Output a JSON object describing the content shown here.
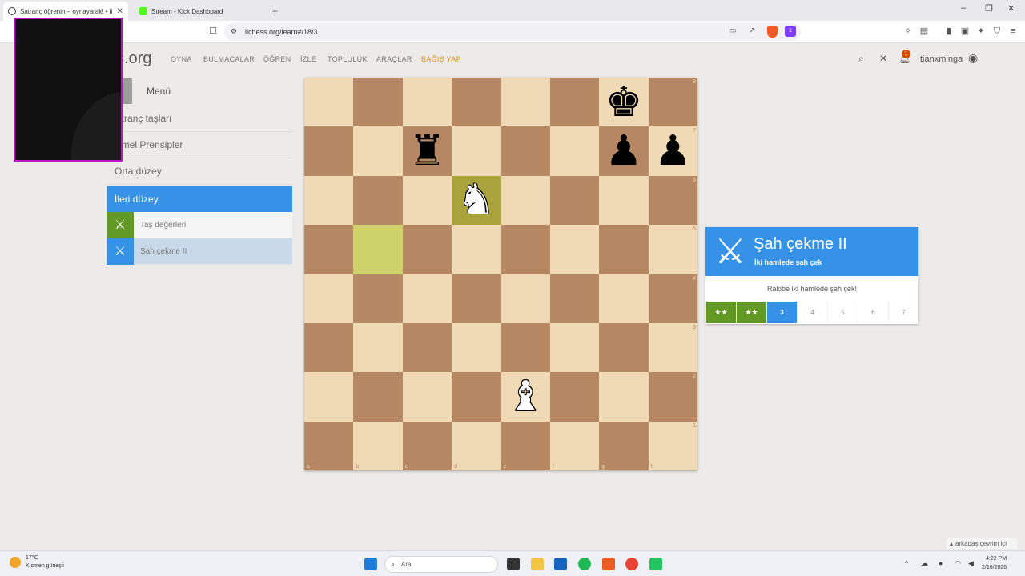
{
  "browser": {
    "tabs": [
      {
        "title": "Satranç öğrenin – oynayarak! • li",
        "active": true
      },
      {
        "title": "Stream - Kick Dashboard",
        "active": false
      }
    ],
    "new_tab": "+",
    "url": "lichess.org/learn#/18/3",
    "ext_badge": "1"
  },
  "site": {
    "logo": "s.org",
    "nav": [
      "OYNA",
      "BULMACALAR",
      "ÖĞREN",
      "İZLE",
      "TOPLULUK",
      "ARAÇLAR"
    ],
    "donate": "BAĞIŞ YAP",
    "username": "tianxminga",
    "notif_count": "1"
  },
  "menu": {
    "title": "Menü",
    "sections": [
      "atranç taşları",
      "emel Prensipler",
      "Orta düzey"
    ],
    "active_section": "İleri düzey",
    "stages": [
      {
        "label": "Taş değerleri",
        "icon": "sword-icon",
        "color": "#629924"
      },
      {
        "label": "Şah çekme II",
        "icon": "crossed-swords-icon",
        "color": "#3692e7"
      }
    ]
  },
  "board": {
    "files": [
      "a",
      "b",
      "c",
      "d",
      "e",
      "f",
      "g",
      "h"
    ],
    "ranks": [
      "8",
      "7",
      "6",
      "5",
      "4",
      "3",
      "2",
      "1"
    ],
    "pieces": [
      {
        "square": "g8",
        "glyph": "♚",
        "color": "black",
        "name": "black-king"
      },
      {
        "square": "c7",
        "glyph": "♜",
        "color": "black",
        "name": "black-rook"
      },
      {
        "square": "g7",
        "glyph": "♟",
        "color": "black",
        "name": "black-pawn"
      },
      {
        "square": "h7",
        "glyph": "♟",
        "color": "black",
        "name": "black-pawn"
      },
      {
        "square": "d6",
        "glyph": "♞",
        "color": "white",
        "name": "white-knight"
      },
      {
        "square": "e2",
        "glyph": "♝",
        "color": "white",
        "name": "white-bishop"
      }
    ],
    "highlights": [
      "d6",
      "b5"
    ]
  },
  "lesson": {
    "title": "Şah çekme II",
    "subtitle": "İki hamlede şah çek",
    "goal": "Rakibe iki hamlede şah çek!",
    "levels": [
      "★★",
      "★★",
      "3",
      "4",
      "5",
      "6",
      "7"
    ],
    "completed_levels": 2,
    "current_level": "3"
  },
  "friends_bar": "arkadaş çevrim içi",
  "taskbar": {
    "weather_temp": "17°C",
    "weather_desc": "Kısmen güneşli",
    "search_placeholder": "Ara",
    "time": "4:22 PM",
    "date": "2/16/2026"
  }
}
